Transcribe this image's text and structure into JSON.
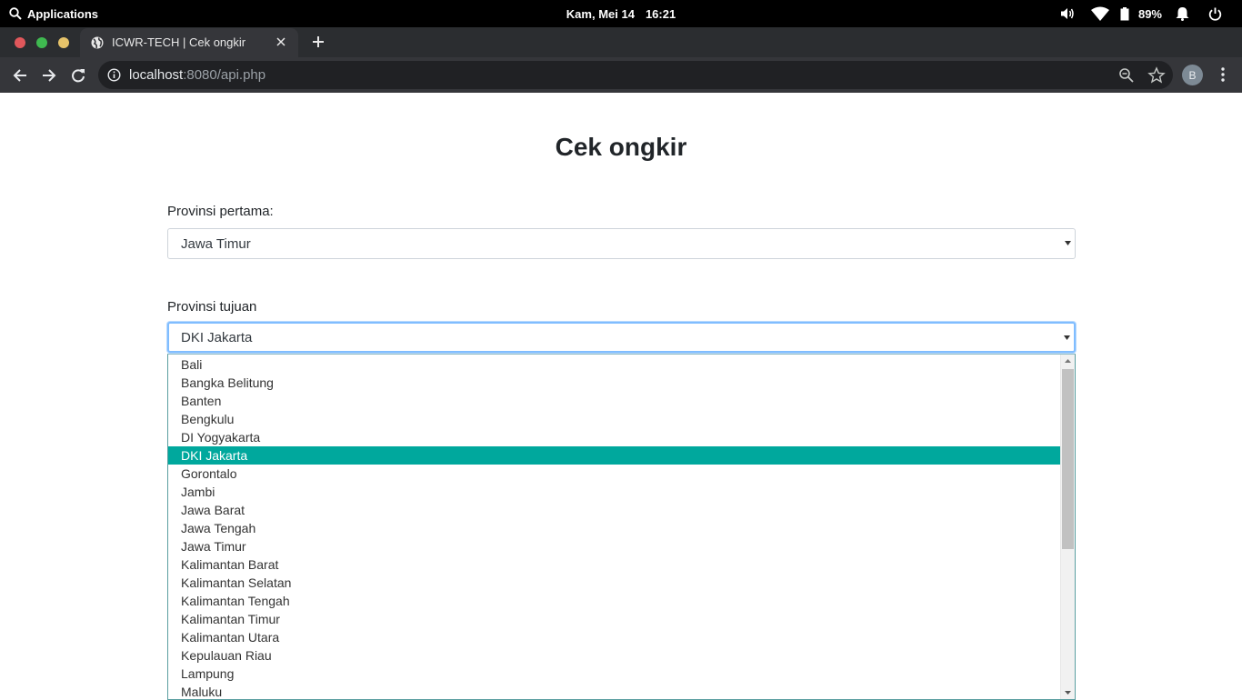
{
  "system_bar": {
    "apps_label": "Applications",
    "date": "Kam, Mei 14",
    "time": "16:21",
    "battery": "89%",
    "icons": [
      "search-icon",
      "volume-icon",
      "wifi-icon",
      "battery-icon",
      "bell-icon",
      "power-icon"
    ]
  },
  "browser": {
    "tab_title": "ICWR-TECH | Cek ongkir",
    "url_host": "localhost",
    "url_rest": ":8080/api.php",
    "profile_initial": "B",
    "icons": [
      "globe-icon",
      "close-icon",
      "plus-icon",
      "back-icon",
      "forward-icon",
      "reload-icon",
      "info-icon",
      "zoom-icon",
      "star-icon",
      "menu-dots-icon"
    ]
  },
  "page": {
    "title": "Cek ongkir",
    "origin": {
      "label": "Provinsi pertama:",
      "value": "Jawa Timur"
    },
    "destination": {
      "label": "Provinsi tujuan",
      "value": "DKI Jakarta"
    },
    "dropdown_options": [
      "Bali",
      "Bangka Belitung",
      "Banten",
      "Bengkulu",
      "DI Yogyakarta",
      "DKI Jakarta",
      "Gorontalo",
      "Jambi",
      "Jawa Barat",
      "Jawa Tengah",
      "Jawa Timur",
      "Kalimantan Barat",
      "Kalimantan Selatan",
      "Kalimantan Tengah",
      "Kalimantan Timur",
      "Kalimantan Utara",
      "Kepulauan Riau",
      "Lampung",
      "Maluku"
    ],
    "selected_option": "DKI Jakarta"
  },
  "colors": {
    "selected_bg": "#00a89d",
    "focus_border": "#80bdff"
  }
}
